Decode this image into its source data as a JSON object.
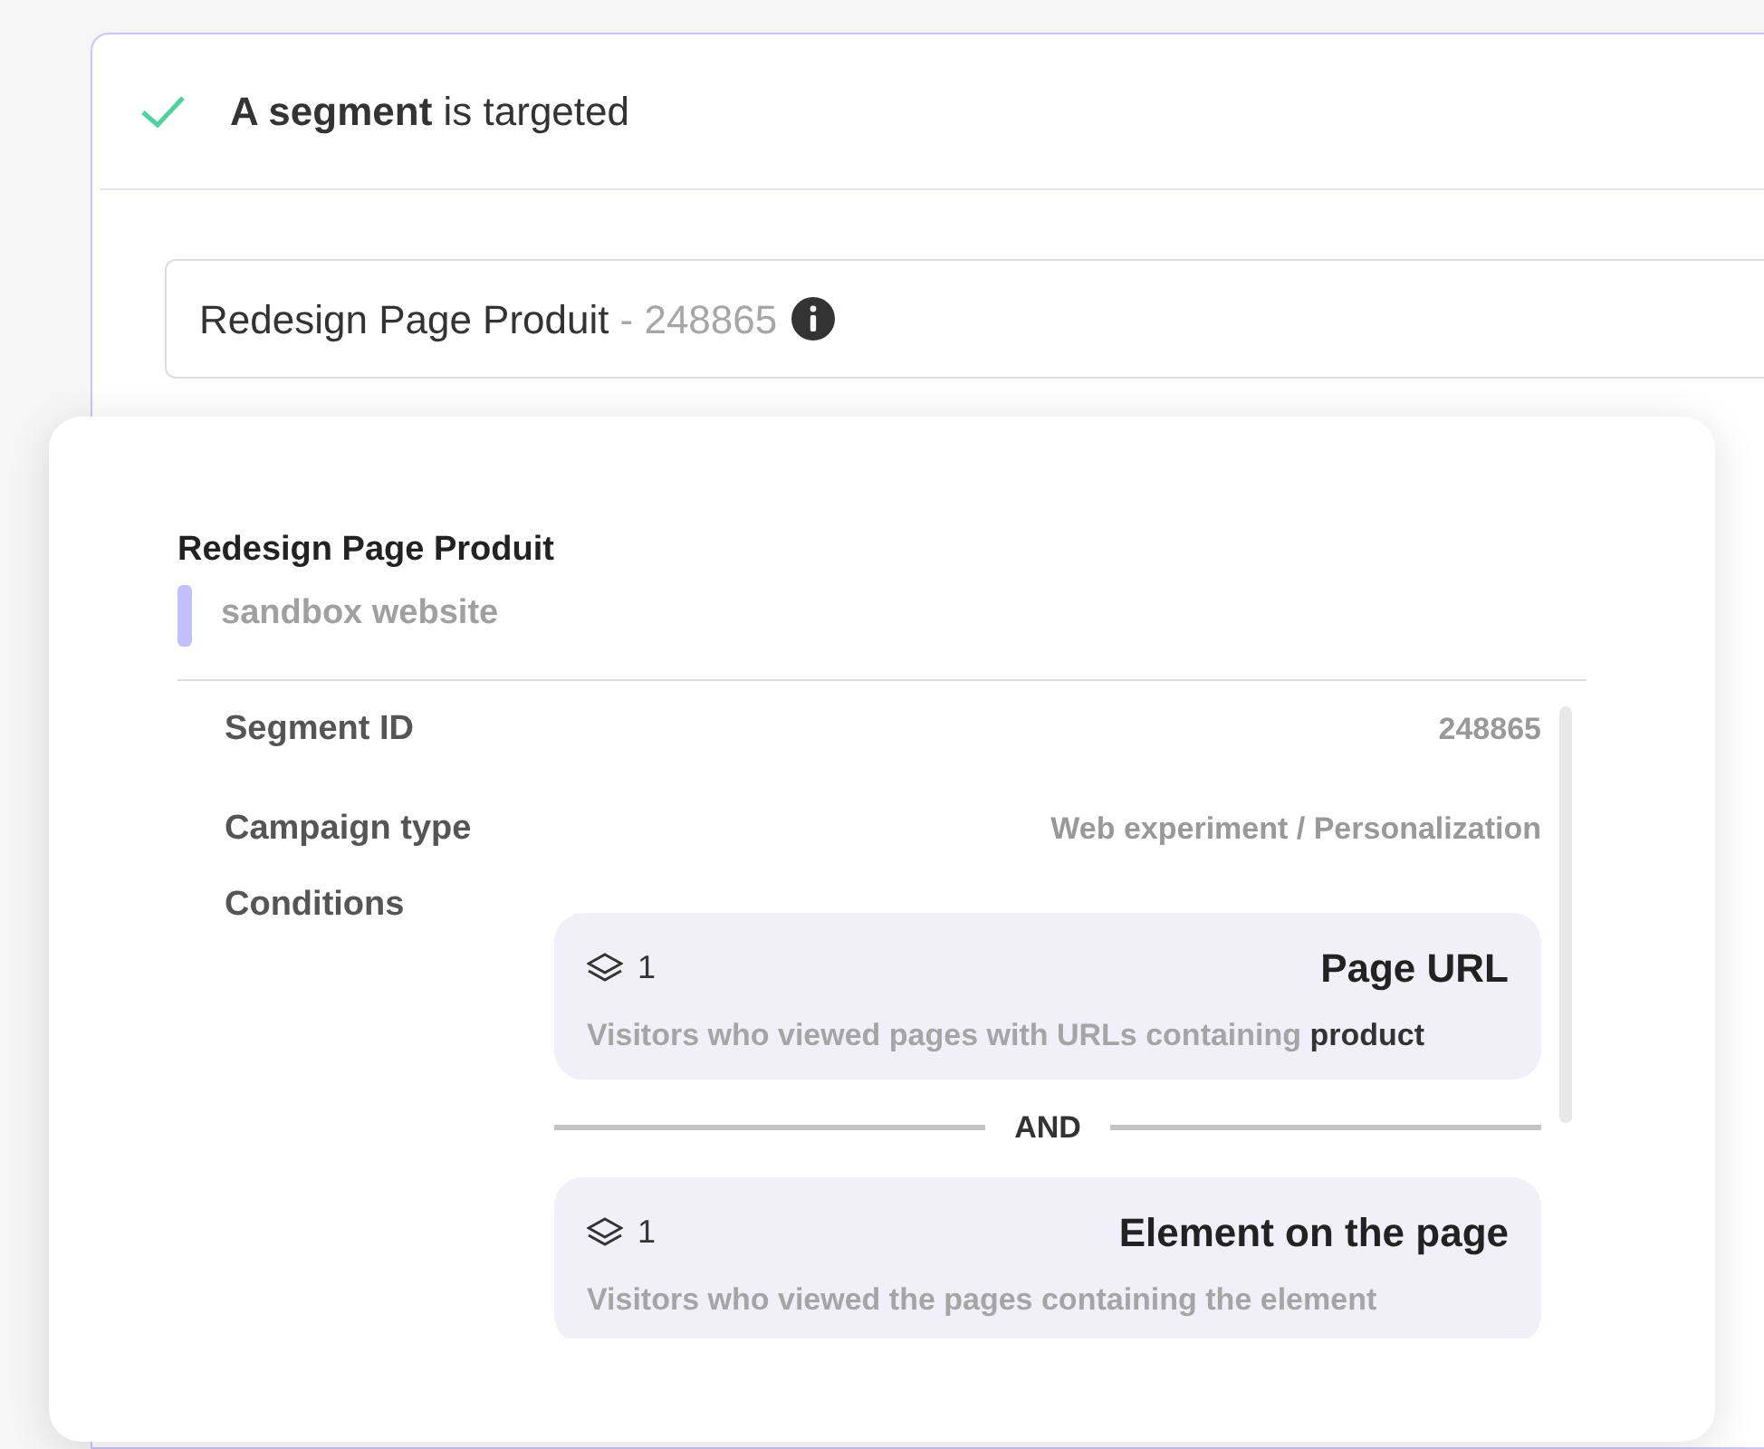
{
  "step": {
    "title": "**A segment** is targeted"
  },
  "segment_field": {
    "name": "Redesign Page Produit",
    "suffix": "- 248865"
  },
  "popover": {
    "title": "Redesign Page Produit",
    "subtitle": "sandbox website",
    "details": [
      {
        "label": "Segment ID",
        "value": "248865"
      },
      {
        "label": "Campaign type",
        "value": "Web experiment / Personalization"
      }
    ],
    "conditions_label": "Conditions",
    "conditions": [
      {
        "count": "1",
        "title": "Page URL",
        "description": "Visitors who viewed pages with URLs containing **product**"
      },
      {
        "count": "1",
        "title": "Element on the page",
        "description": "Visitors who viewed the pages containing the element"
      }
    ],
    "operator": "AND"
  }
}
